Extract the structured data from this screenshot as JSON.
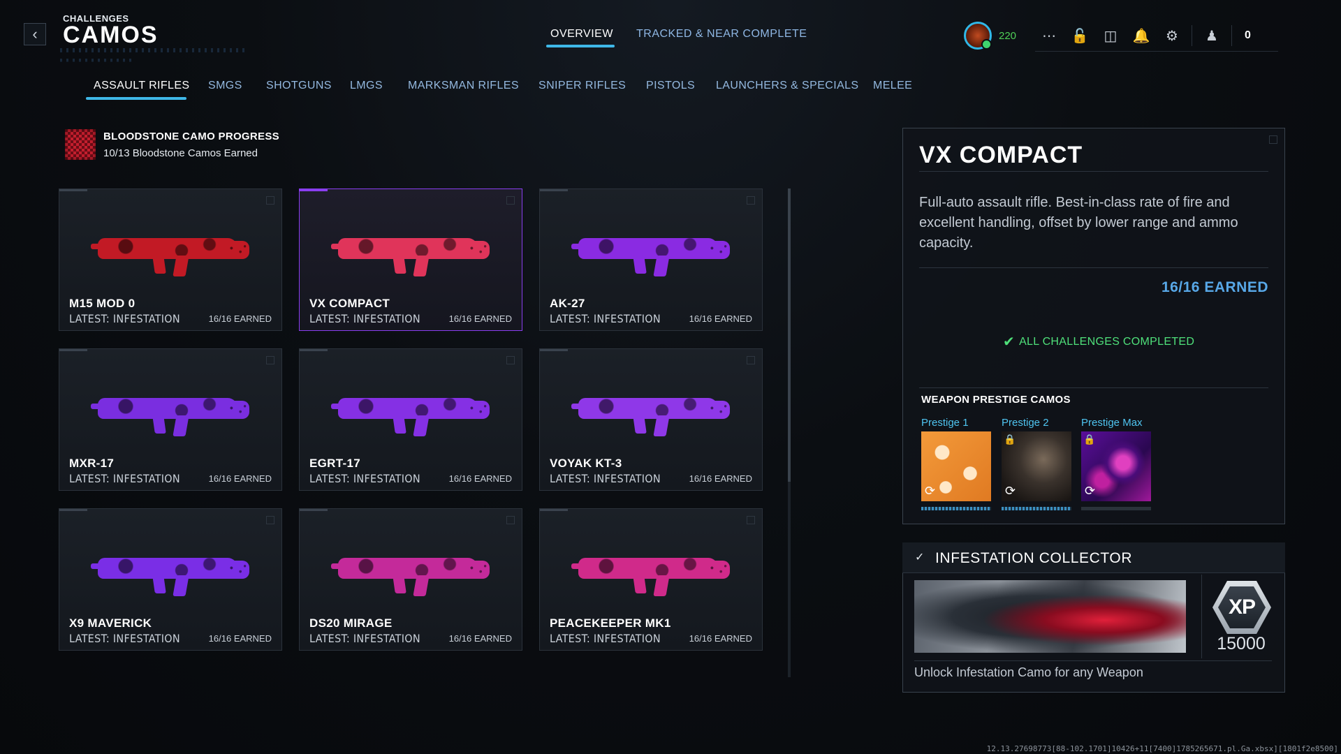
{
  "header": {
    "section_small": "CHALLENGES",
    "section_title": "CAMOS",
    "back_icon": "chevron-left-icon",
    "tabs": [
      {
        "label": "OVERVIEW",
        "active": true
      },
      {
        "label": "TRACKED & NEAR COMPLETE",
        "active": false
      }
    ],
    "player_level": "220",
    "currency_count": "0",
    "icons": [
      "apps-grid-icon",
      "unlock-icon",
      "id-card-icon",
      "bell-icon",
      "gear-icon",
      "squad-icon"
    ]
  },
  "categories": [
    {
      "label": "ASSAULT RIFLES",
      "active": true
    },
    {
      "label": "SMGS",
      "active": false
    },
    {
      "label": "SHOTGUNS",
      "active": false
    },
    {
      "label": "LMGS",
      "active": false
    },
    {
      "label": "MARKSMAN RIFLES",
      "active": false
    },
    {
      "label": "SNIPER RIFLES",
      "active": false
    },
    {
      "label": "PISTOLS",
      "active": false
    },
    {
      "label": "LAUNCHERS & SPECIALS",
      "active": false
    },
    {
      "label": "MELEE",
      "active": false
    }
  ],
  "bloodstone": {
    "title": "BLOODSTONE CAMO PROGRESS",
    "subtitle": "10/13 Bloodstone Camos Earned"
  },
  "weapons": [
    {
      "name": "M15 MOD 0",
      "latest": "LATEST: INFESTATION",
      "earned": "16/16 EARNED",
      "color": "#c21a25",
      "selected": false
    },
    {
      "name": "VX COMPACT",
      "latest": "LATEST: INFESTATION",
      "earned": "16/16 EARNED",
      "color": "#e0345a",
      "selected": true
    },
    {
      "name": "AK-27",
      "latest": "LATEST: INFESTATION",
      "earned": "16/16 EARNED",
      "color": "#8a2be2",
      "selected": false
    },
    {
      "name": "MXR-17",
      "latest": "LATEST: INFESTATION",
      "earned": "16/16 EARNED",
      "color": "#7a2ee0",
      "selected": false
    },
    {
      "name": "EGRT-17",
      "latest": "LATEST: INFESTATION",
      "earned": "16/16 EARNED",
      "color": "#8530e4",
      "selected": false
    },
    {
      "name": "VOYAK KT-3",
      "latest": "LATEST: INFESTATION",
      "earned": "16/16 EARNED",
      "color": "#8f38e8",
      "selected": false
    },
    {
      "name": "X9 MAVERICK",
      "latest": "LATEST: INFESTATION",
      "earned": "16/16 EARNED",
      "color": "#7a2ee6",
      "selected": false
    },
    {
      "name": "DS20 MIRAGE",
      "latest": "LATEST: INFESTATION",
      "earned": "16/16 EARNED",
      "color": "#c42a9a",
      "selected": false
    },
    {
      "name": "PEACEKEEPER MK1",
      "latest": "LATEST: INFESTATION",
      "earned": "16/16 EARNED",
      "color": "#d02a8a",
      "selected": false
    }
  ],
  "detail": {
    "title": "VX COMPACT",
    "description": "Full-auto assault rifle. Best-in-class rate of fire and excellent handling, offset by lower range and ammo capacity.",
    "earned": "16/16 EARNED",
    "status": "ALL CHALLENGES COMPLETED",
    "prestige_title": "WEAPON PRESTIGE CAMOS",
    "prestige": [
      {
        "label": "Prestige 1",
        "locked": false
      },
      {
        "label": "Prestige 2",
        "locked": true
      },
      {
        "label": "Prestige Max",
        "locked": true
      }
    ]
  },
  "collector": {
    "title": "INFESTATION COLLECTOR",
    "xp_label": "XP",
    "xp_value": "15000",
    "description": "Unlock Infestation Camo for any Weapon"
  },
  "build_string": "12.13.27698773[88-102.1701]10426+11[7400]1785265671.pl.Ga.xbsx][1801f2e8500]"
}
